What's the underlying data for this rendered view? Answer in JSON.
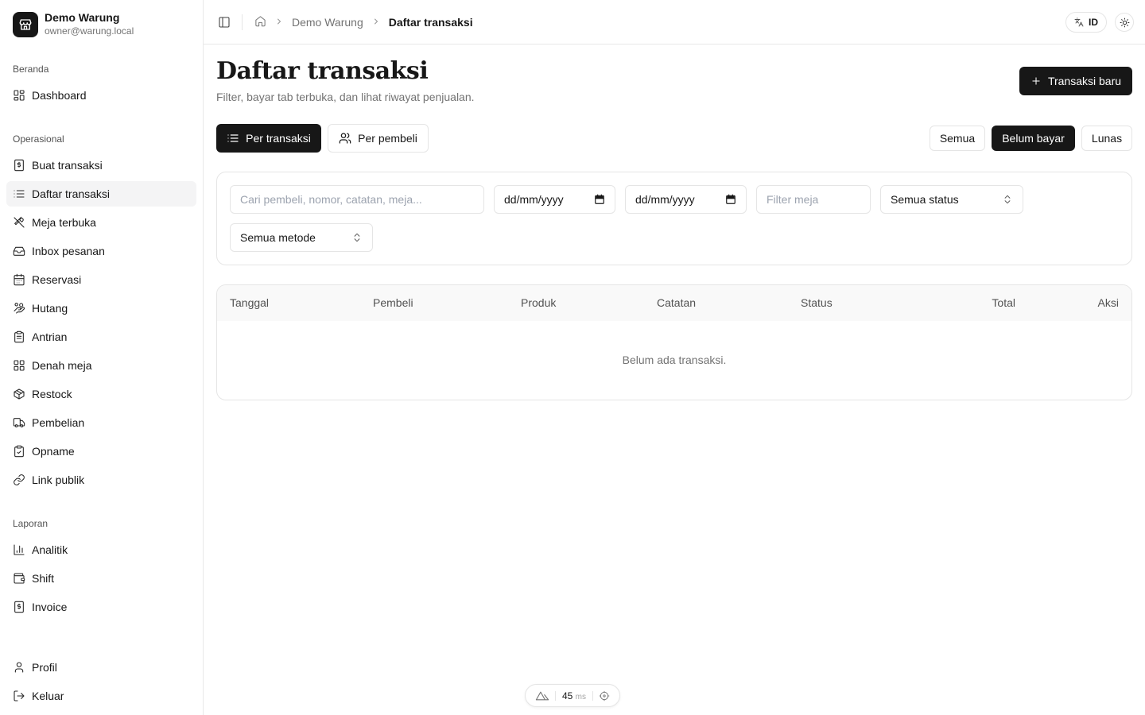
{
  "app": {
    "name": "Demo Warung",
    "email": "owner@warung.local"
  },
  "sidebar": {
    "groups": [
      {
        "label": "Beranda",
        "items": [
          {
            "label": "Dashboard",
            "icon": "dashboard-icon"
          }
        ]
      },
      {
        "label": "Operasional",
        "items": [
          {
            "label": "Buat transaksi",
            "icon": "receipt-icon"
          },
          {
            "label": "Daftar transaksi",
            "icon": "list-icon",
            "active": true
          },
          {
            "label": "Meja terbuka",
            "icon": "utensils-icon"
          },
          {
            "label": "Inbox pesanan",
            "icon": "inbox-icon"
          },
          {
            "label": "Reservasi",
            "icon": "calendar-icon"
          },
          {
            "label": "Hutang",
            "icon": "hand-coins-icon"
          },
          {
            "label": "Antrian",
            "icon": "clipboard-icon"
          },
          {
            "label": "Denah meja",
            "icon": "grid-icon"
          },
          {
            "label": "Restock",
            "icon": "package-icon"
          },
          {
            "label": "Pembelian",
            "icon": "truck-icon"
          },
          {
            "label": "Opname",
            "icon": "clipboard-check-icon"
          },
          {
            "label": "Link publik",
            "icon": "link-icon"
          }
        ]
      },
      {
        "label": "Laporan",
        "items": [
          {
            "label": "Analitik",
            "icon": "chart-icon"
          },
          {
            "label": "Shift",
            "icon": "wallet-icon"
          },
          {
            "label": "Invoice",
            "icon": "invoice-icon"
          }
        ]
      }
    ],
    "footer": [
      {
        "label": "Profil",
        "icon": "user-icon"
      },
      {
        "label": "Keluar",
        "icon": "logout-icon"
      }
    ]
  },
  "topbar": {
    "breadcrumb": {
      "parent": "Demo Warung",
      "current": "Daftar transaksi"
    },
    "language": "ID"
  },
  "page": {
    "title": "Daftar transaksi",
    "subtitle": "Filter, bayar tab terbuka, dan lihat riwayat penjualan.",
    "new_button": "Transaksi baru"
  },
  "view_toggle": {
    "per_transaction": "Per transaksi",
    "per_buyer": "Per pembeli"
  },
  "status_tabs": {
    "all": "Semua",
    "unpaid": "Belum bayar",
    "paid": "Lunas",
    "selected": "Belum bayar"
  },
  "filters": {
    "search_placeholder": "Cari pembeli, nomor, catatan, meja...",
    "date_from": "dd/mm/yyyy",
    "date_to": "dd/mm/yyyy",
    "table_placeholder": "Filter meja",
    "status_value": "Semua status",
    "method_value": "Semua metode"
  },
  "table": {
    "columns": {
      "date": "Tanggal",
      "buyer": "Pembeli",
      "product": "Produk",
      "note": "Catatan",
      "status": "Status",
      "total": "Total",
      "action": "Aksi"
    },
    "empty_text": "Belum ada transaksi."
  },
  "dev_indicator": {
    "value": "45",
    "unit": "ms"
  },
  "colors": {
    "primary": "#171717",
    "border": "#e5e5e5",
    "muted_text": "#737373",
    "active_bg": "#f4f4f5"
  }
}
